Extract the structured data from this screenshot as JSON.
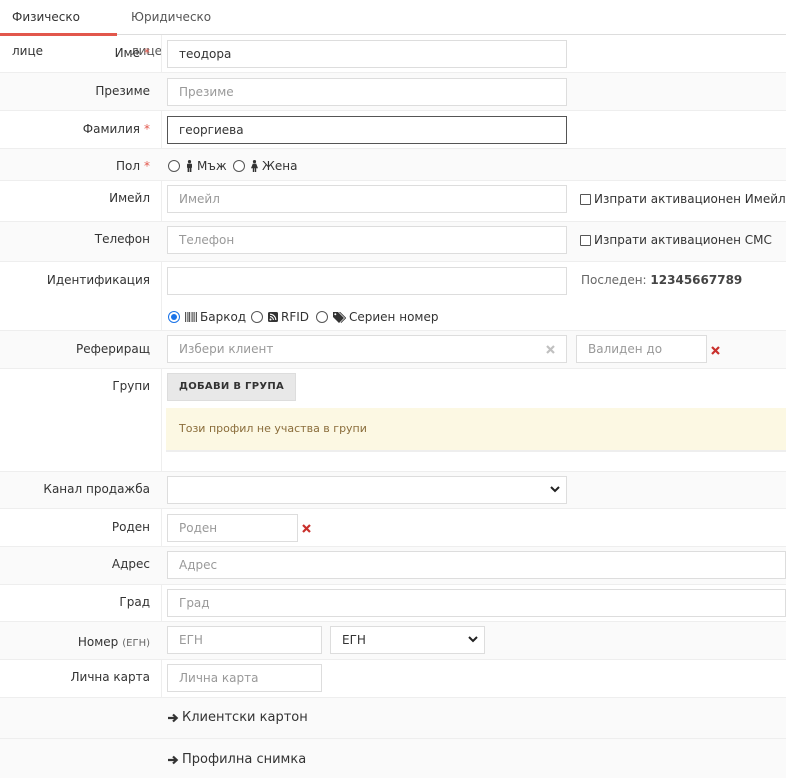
{
  "tabs": [
    {
      "label": "Физическо лице",
      "active": true
    },
    {
      "label": "Юридическо лице",
      "active": false
    }
  ],
  "required_marker": "*",
  "first_name": {
    "label": "Име",
    "value": "теодора"
  },
  "middle_name": {
    "label": "Презиме",
    "placeholder": "Презиме"
  },
  "last_name": {
    "label": "Фамилия",
    "value": "георгиева"
  },
  "gender": {
    "label": "Пол",
    "options": [
      "Мъж",
      "Жена"
    ]
  },
  "email": {
    "label": "Имейл",
    "placeholder": "Имейл",
    "checkbox_label": "Изпрати активационен Имейл"
  },
  "phone": {
    "label": "Телефон",
    "placeholder": "Телефон",
    "checkbox_label": "Изпрати активационен СМС"
  },
  "identification": {
    "label": "Идентификация",
    "value": "",
    "last_label": "Последен:",
    "last_value": "12345667789",
    "options": [
      "Баркод",
      "RFID",
      "Сериен номер"
    ],
    "selected": "Баркод"
  },
  "referrer": {
    "label": "Рефериращ",
    "placeholder": "Избери клиент",
    "valid_until_placeholder": "Валиден до"
  },
  "groups": {
    "label": "Групи",
    "add_button": "ДОБАВИ В ГРУПА",
    "notice": "Този профил не участва в групи"
  },
  "sales_channel": {
    "label": "Канал продажба",
    "value": ""
  },
  "birth": {
    "label": "Роден",
    "placeholder": "Роден"
  },
  "address": {
    "label": "Адрес",
    "placeholder": "Адрес"
  },
  "city": {
    "label": "Град",
    "placeholder": "Град"
  },
  "number": {
    "label": "Номер",
    "sub_label": "(ЕГН)",
    "placeholder": "ЕГН",
    "type_value": "ЕГН"
  },
  "id_card": {
    "label": "Лична карта",
    "placeholder": "Лична карта"
  },
  "sections": [
    "Клиентски картон",
    "Профилна снимка"
  ],
  "icons": {
    "male": "male-icon",
    "female": "female-icon",
    "barcode": "barcode-icon",
    "rfid": "rfid-icon",
    "serial": "tags-icon",
    "clear": "times-icon",
    "remove": "times-icon",
    "caret": "chevron-down-icon",
    "arrow": "arrow-right-icon"
  },
  "colors": {
    "accent": "#e2574c",
    "radio": "#1a73e8",
    "notice_bg": "#fcf8e3",
    "notice_text": "#8a6d3b",
    "remove": "#c9302c"
  }
}
